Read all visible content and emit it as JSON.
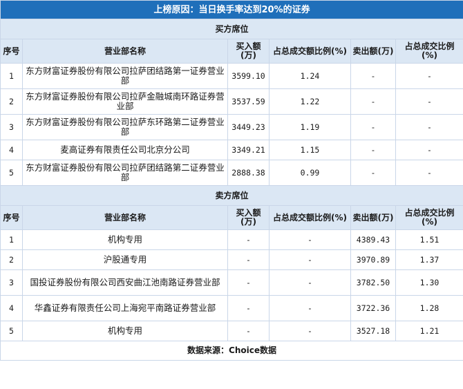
{
  "title": "上榜原因：当日换手率达到20%的证券",
  "buy_section": {
    "label": "买方席位",
    "columns": [
      "序号",
      "营业部名称",
      "买入额(万)",
      "占总成交额比例(%)",
      "卖出额(万)",
      "占总成交比例(%)"
    ],
    "rows": [
      {
        "no": "1",
        "name": "东方财富证券股份有限公司拉萨团结路第一证券营业部",
        "buy": "3599.10",
        "buy_pct": "1.24",
        "sell": "-",
        "sell_pct": "-"
      },
      {
        "no": "2",
        "name": "东方财富证券股份有限公司拉萨金融城南环路证券营业部",
        "buy": "3537.59",
        "buy_pct": "1.22",
        "sell": "-",
        "sell_pct": "-"
      },
      {
        "no": "3",
        "name": "东方财富证券股份有限公司拉萨东环路第二证券营业部",
        "buy": "3449.23",
        "buy_pct": "1.19",
        "sell": "-",
        "sell_pct": "-"
      },
      {
        "no": "4",
        "name": "麦高证券有限责任公司北京分公司",
        "buy": "3349.21",
        "buy_pct": "1.15",
        "sell": "-",
        "sell_pct": "-"
      },
      {
        "no": "5",
        "name": "东方财富证券股份有限公司拉萨团结路第二证券营业部",
        "buy": "2888.38",
        "buy_pct": "0.99",
        "sell": "-",
        "sell_pct": "-"
      }
    ]
  },
  "sell_section": {
    "label": "卖方席位",
    "columns": [
      "序号",
      "营业部名称",
      "买入额(万)",
      "占总成交额比例(%)",
      "卖出额(万)",
      "占总成交比例(%)"
    ],
    "rows": [
      {
        "no": "1",
        "name": "机构专用",
        "buy": "-",
        "buy_pct": "-",
        "sell": "4389.43",
        "sell_pct": "1.51"
      },
      {
        "no": "2",
        "name": "沪股通专用",
        "buy": "-",
        "buy_pct": "-",
        "sell": "3970.89",
        "sell_pct": "1.37"
      },
      {
        "no": "3",
        "name": "国投证券股份有限公司西安曲江池南路证券营业部",
        "buy": "-",
        "buy_pct": "-",
        "sell": "3782.50",
        "sell_pct": "1.30"
      },
      {
        "no": "4",
        "name": "华鑫证券有限责任公司上海宛平南路证券营业部",
        "buy": "-",
        "buy_pct": "-",
        "sell": "3722.36",
        "sell_pct": "1.28"
      },
      {
        "no": "5",
        "name": "机构专用",
        "buy": "-",
        "buy_pct": "-",
        "sell": "3527.18",
        "sell_pct": "1.21"
      }
    ]
  },
  "footer": "数据来源：Choice数据"
}
